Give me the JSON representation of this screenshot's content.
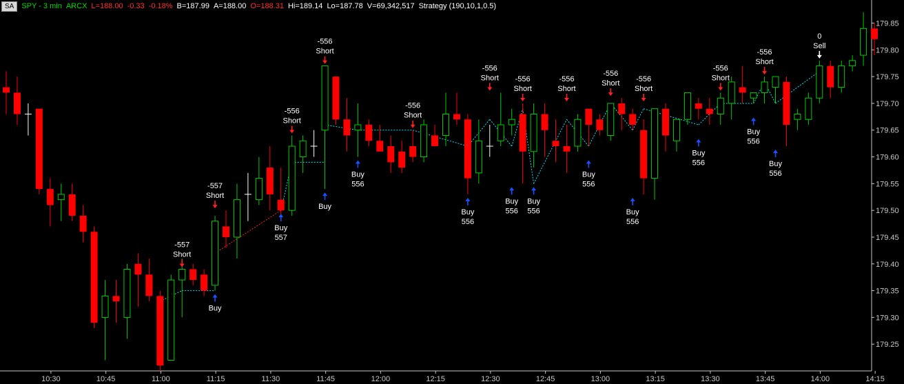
{
  "header": {
    "badge": "SA",
    "symbol": "SPY - 3 min",
    "exchange": "ARCX",
    "last": "L=188.00",
    "change": "-0.33",
    "change_pct": "-0.18%",
    "bid": "B=187.99",
    "ask": "A=188.00",
    "open": "O=188.31",
    "high": "Hi=189.14",
    "low": "Lo=187.78",
    "volume": "V=69,342,517",
    "strategy": "Strategy (190,10,1,0.5)"
  },
  "colors": {
    "background": "#000000",
    "up_candle": "#00cc00",
    "down_candle": "#ff0000",
    "doji": "#ffffff",
    "short_arrow": "#ff2020",
    "buy_arrow": "#1a50ff",
    "sell_arrow": "#ffffff",
    "trade_line_flat": "#00e5ff",
    "trade_line_long": "#ff2020",
    "axis": "#c8c8c8",
    "header_green": "#00d800",
    "header_red": "#ff3030",
    "header_white": "#ffffff"
  },
  "chart_data": {
    "type": "candlestick",
    "interval": "3 min",
    "grid": false,
    "ylim": [
      179.2,
      179.87
    ],
    "y_ticks": [
      "179.85",
      "179.80",
      "179.75",
      "179.70",
      "179.65",
      "179.60",
      "179.55",
      "179.50",
      "179.45",
      "179.40",
      "179.35",
      "179.30",
      "179.25"
    ],
    "x_ticks": [
      {
        "label": "10:30",
        "bar": 2
      },
      {
        "label": "10:45",
        "bar": 7
      },
      {
        "label": "11:00",
        "bar": 12
      },
      {
        "label": "11:15",
        "bar": 17
      },
      {
        "label": "11:30",
        "bar": 22
      },
      {
        "label": "11:45",
        "bar": 27
      },
      {
        "label": "12:00",
        "bar": 32
      },
      {
        "label": "12:15",
        "bar": 37
      },
      {
        "label": "12:30",
        "bar": 42
      },
      {
        "label": "12:45",
        "bar": 47
      },
      {
        "label": "13:00",
        "bar": 52
      },
      {
        "label": "13:15",
        "bar": 57
      },
      {
        "label": "13:30",
        "bar": 62
      },
      {
        "label": "13:45",
        "bar": 67
      },
      {
        "label": "14:00",
        "bar": 72
      },
      {
        "label": "14:15",
        "bar": 77
      }
    ],
    "candles": [
      {
        "o": 179.73,
        "h": 179.76,
        "l": 179.68,
        "c": 179.72
      },
      {
        "o": 179.72,
        "h": 179.75,
        "l": 179.66,
        "c": 179.68
      },
      {
        "o": 179.68,
        "h": 179.7,
        "l": 179.64,
        "c": 179.68
      },
      {
        "o": 179.69,
        "h": 179.69,
        "l": 179.53,
        "c": 179.54
      },
      {
        "o": 179.54,
        "h": 179.56,
        "l": 179.47,
        "c": 179.51
      },
      {
        "o": 179.52,
        "h": 179.55,
        "l": 179.48,
        "c": 179.53
      },
      {
        "o": 179.53,
        "h": 179.55,
        "l": 179.48,
        "c": 179.49
      },
      {
        "o": 179.49,
        "h": 179.51,
        "l": 179.44,
        "c": 179.46
      },
      {
        "o": 179.46,
        "h": 179.47,
        "l": 179.28,
        "c": 179.29
      },
      {
        "o": 179.3,
        "h": 179.37,
        "l": 179.22,
        "c": 179.34
      },
      {
        "o": 179.34,
        "h": 179.37,
        "l": 179.29,
        "c": 179.33
      },
      {
        "o": 179.3,
        "h": 179.4,
        "l": 179.26,
        "c": 179.39
      },
      {
        "o": 179.4,
        "h": 179.42,
        "l": 179.32,
        "c": 179.38
      },
      {
        "o": 179.38,
        "h": 179.41,
        "l": 179.33,
        "c": 179.34
      },
      {
        "o": 179.34,
        "h": 179.35,
        "l": 179.2,
        "c": 179.21
      },
      {
        "o": 179.22,
        "h": 179.38,
        "l": 179.22,
        "c": 179.37
      },
      {
        "o": 179.37,
        "h": 179.41,
        "l": 179.3,
        "c": 179.39
      },
      {
        "o": 179.39,
        "h": 179.4,
        "l": 179.36,
        "c": 179.37
      },
      {
        "o": 179.38,
        "h": 179.39,
        "l": 179.34,
        "c": 179.35
      },
      {
        "o": 179.36,
        "h": 179.49,
        "l": 179.35,
        "c": 179.48
      },
      {
        "o": 179.47,
        "h": 179.5,
        "l": 179.43,
        "c": 179.45
      },
      {
        "o": 179.45,
        "h": 179.55,
        "l": 179.41,
        "c": 179.52
      },
      {
        "o": 179.53,
        "h": 179.57,
        "l": 179.48,
        "c": 179.53
      },
      {
        "o": 179.52,
        "h": 179.6,
        "l": 179.51,
        "c": 179.56
      },
      {
        "o": 179.58,
        "h": 179.62,
        "l": 179.5,
        "c": 179.53
      },
      {
        "o": 179.52,
        "h": 179.58,
        "l": 179.49,
        "c": 179.5
      },
      {
        "o": 179.5,
        "h": 179.64,
        "l": 179.49,
        "c": 179.62
      },
      {
        "o": 179.6,
        "h": 179.64,
        "l": 179.57,
        "c": 179.63
      },
      {
        "o": 179.62,
        "h": 179.65,
        "l": 179.6,
        "c": 179.62
      },
      {
        "o": 179.65,
        "h": 179.77,
        "l": 179.54,
        "c": 179.77
      },
      {
        "o": 179.75,
        "h": 179.75,
        "l": 179.66,
        "c": 179.67
      },
      {
        "o": 179.67,
        "h": 179.71,
        "l": 179.61,
        "c": 179.64
      },
      {
        "o": 179.65,
        "h": 179.7,
        "l": 179.6,
        "c": 179.66
      },
      {
        "o": 179.66,
        "h": 179.67,
        "l": 179.62,
        "c": 179.63
      },
      {
        "o": 179.63,
        "h": 179.66,
        "l": 179.61,
        "c": 179.61
      },
      {
        "o": 179.62,
        "h": 179.64,
        "l": 179.57,
        "c": 179.59
      },
      {
        "o": 179.61,
        "h": 179.63,
        "l": 179.57,
        "c": 179.58
      },
      {
        "o": 179.62,
        "h": 179.65,
        "l": 179.59,
        "c": 179.6
      },
      {
        "o": 179.6,
        "h": 179.67,
        "l": 179.59,
        "c": 179.66
      },
      {
        "o": 179.64,
        "h": 179.66,
        "l": 179.62,
        "c": 179.62
      },
      {
        "o": 179.64,
        "h": 179.72,
        "l": 179.62,
        "c": 179.68
      },
      {
        "o": 179.68,
        "h": 179.72,
        "l": 179.66,
        "c": 179.67
      },
      {
        "o": 179.67,
        "h": 179.68,
        "l": 179.53,
        "c": 179.56
      },
      {
        "o": 179.57,
        "h": 179.67,
        "l": 179.55,
        "c": 179.63
      },
      {
        "o": 179.62,
        "h": 179.66,
        "l": 179.6,
        "c": 179.62
      },
      {
        "o": 179.63,
        "h": 179.72,
        "l": 179.62,
        "c": 179.66
      },
      {
        "o": 179.66,
        "h": 179.69,
        "l": 179.64,
        "c": 179.67
      },
      {
        "o": 179.68,
        "h": 179.7,
        "l": 179.55,
        "c": 179.61
      },
      {
        "o": 179.61,
        "h": 179.7,
        "l": 179.58,
        "c": 179.68
      },
      {
        "o": 179.68,
        "h": 179.7,
        "l": 179.6,
        "c": 179.65
      },
      {
        "o": 179.63,
        "h": 179.67,
        "l": 179.59,
        "c": 179.62
      },
      {
        "o": 179.62,
        "h": 179.66,
        "l": 179.57,
        "c": 179.61
      },
      {
        "o": 179.62,
        "h": 179.68,
        "l": 179.61,
        "c": 179.67
      },
      {
        "o": 179.69,
        "h": 179.69,
        "l": 179.62,
        "c": 179.66
      },
      {
        "o": 179.67,
        "h": 179.68,
        "l": 179.64,
        "c": 179.65
      },
      {
        "o": 179.64,
        "h": 179.69,
        "l": 179.63,
        "c": 179.7
      },
      {
        "o": 179.7,
        "h": 179.71,
        "l": 179.65,
        "c": 179.68
      },
      {
        "o": 179.68,
        "h": 179.69,
        "l": 179.65,
        "c": 179.66
      },
      {
        "o": 179.65,
        "h": 179.67,
        "l": 179.53,
        "c": 179.56
      },
      {
        "o": 179.56,
        "h": 179.69,
        "l": 179.52,
        "c": 179.69
      },
      {
        "o": 179.69,
        "h": 179.7,
        "l": 179.61,
        "c": 179.64
      },
      {
        "o": 179.63,
        "h": 179.67,
        "l": 179.61,
        "c": 179.67
      },
      {
        "o": 179.67,
        "h": 179.72,
        "l": 179.66,
        "c": 179.72
      },
      {
        "o": 179.7,
        "h": 179.71,
        "l": 179.67,
        "c": 179.69
      },
      {
        "o": 179.69,
        "h": 179.71,
        "l": 179.66,
        "c": 179.68
      },
      {
        "o": 179.68,
        "h": 179.72,
        "l": 179.66,
        "c": 179.71
      },
      {
        "o": 179.7,
        "h": 179.75,
        "l": 179.67,
        "c": 179.74
      },
      {
        "o": 179.73,
        "h": 179.77,
        "l": 179.7,
        "c": 179.72
      },
      {
        "o": 179.71,
        "h": 179.72,
        "l": 179.7,
        "c": 179.72
      },
      {
        "o": 179.72,
        "h": 179.75,
        "l": 179.7,
        "c": 179.74
      },
      {
        "o": 179.73,
        "h": 179.75,
        "l": 179.7,
        "c": 179.75
      },
      {
        "o": 179.74,
        "h": 179.75,
        "l": 179.62,
        "c": 179.66
      },
      {
        "o": 179.67,
        "h": 179.69,
        "l": 179.65,
        "c": 179.68
      },
      {
        "o": 179.67,
        "h": 179.72,
        "l": 179.66,
        "c": 179.71
      },
      {
        "o": 179.71,
        "h": 179.78,
        "l": 179.7,
        "c": 179.77
      },
      {
        "o": 179.77,
        "h": 179.78,
        "l": 179.71,
        "c": 179.73
      },
      {
        "o": 179.73,
        "h": 179.78,
        "l": 179.72,
        "c": 179.77
      },
      {
        "o": 179.77,
        "h": 179.79,
        "l": 179.76,
        "c": 179.78
      },
      {
        "o": 179.79,
        "h": 179.87,
        "l": 179.77,
        "c": 179.84
      },
      {
        "o": 179.84,
        "h": 179.85,
        "l": 179.79,
        "c": 179.82
      }
    ],
    "signals": [
      {
        "bar": 16,
        "type": "short",
        "qty": "-557",
        "label": "Short",
        "price": 179.39
      },
      {
        "bar": 19,
        "type": "buy",
        "qty": "",
        "label": "Buy",
        "price": 179.35
      },
      {
        "bar": 19,
        "type": "short",
        "qty": "-557",
        "label": "Short",
        "price": 179.5
      },
      {
        "bar": 25,
        "type": "buy",
        "qty": "557",
        "label": "Buy",
        "price": 179.5
      },
      {
        "bar": 26,
        "type": "short",
        "qty": "-556",
        "label": "Short",
        "price": 179.64
      },
      {
        "bar": 29,
        "type": "short",
        "qty": "-556",
        "label": "Short",
        "price": 179.77
      },
      {
        "bar": 29,
        "type": "buy",
        "qty": "",
        "label": "Buy",
        "price": 179.54
      },
      {
        "bar": 32,
        "type": "buy",
        "qty": "556",
        "label": "Buy",
        "price": 179.6
      },
      {
        "bar": 37,
        "type": "short",
        "qty": "-556",
        "label": "Short",
        "price": 179.65
      },
      {
        "bar": 42,
        "type": "buy",
        "qty": "556",
        "label": "Buy",
        "price": 179.53
      },
      {
        "bar": 44,
        "type": "short",
        "qty": "-556",
        "label": "Short",
        "price": 179.72
      },
      {
        "bar": 46,
        "type": "buy",
        "qty": "556",
        "label": "Buy",
        "price": 179.55
      },
      {
        "bar": 47,
        "type": "short",
        "qty": "-556",
        "label": "Short",
        "price": 179.7
      },
      {
        "bar": 48,
        "type": "buy",
        "qty": "556",
        "label": "Buy",
        "price": 179.55
      },
      {
        "bar": 51,
        "type": "short",
        "qty": "-556",
        "label": "Short",
        "price": 179.7
      },
      {
        "bar": 53,
        "type": "buy",
        "qty": "556",
        "label": "Buy",
        "price": 179.6
      },
      {
        "bar": 55,
        "type": "short",
        "qty": "-556",
        "label": "Short",
        "price": 179.71
      },
      {
        "bar": 57,
        "type": "buy",
        "qty": "556",
        "label": "Buy",
        "price": 179.53
      },
      {
        "bar": 58,
        "type": "short",
        "qty": "-556",
        "label": "Short",
        "price": 179.7
      },
      {
        "bar": 63,
        "type": "buy",
        "qty": "556",
        "label": "Buy",
        "price": 179.64
      },
      {
        "bar": 65,
        "type": "short",
        "qty": "-556",
        "label": "Short",
        "price": 179.72
      },
      {
        "bar": 68,
        "type": "buy",
        "qty": "556",
        "label": "Buy",
        "price": 179.68
      },
      {
        "bar": 69,
        "type": "short",
        "qty": "-556",
        "label": "Short",
        "price": 179.75
      },
      {
        "bar": 70,
        "type": "buy",
        "qty": "556",
        "label": "Buy",
        "price": 179.62
      },
      {
        "bar": 74,
        "type": "sell",
        "qty": "0",
        "label": "Sell",
        "price": 179.78
      }
    ],
    "trade_path": [
      {
        "bar": 14,
        "price": 179.33,
        "style": "flat"
      },
      {
        "bar": 16,
        "price": 179.35,
        "style": "flat"
      },
      {
        "bar": 19,
        "price": 179.35,
        "style": "long"
      },
      {
        "bar": 19,
        "price": 179.42,
        "style": "long"
      },
      {
        "bar": 25,
        "price": 179.5,
        "style": "flat"
      },
      {
        "bar": 26,
        "price": 179.59,
        "style": "flat"
      },
      {
        "bar": 29,
        "price": 179.59,
        "style": "flat"
      },
      {
        "bar": 29,
        "price": 179.66,
        "style": "flat"
      },
      {
        "bar": 32,
        "price": 179.65,
        "style": "flat"
      },
      {
        "bar": 37,
        "price": 179.65,
        "style": "flat"
      },
      {
        "bar": 42,
        "price": 179.62,
        "style": "flat"
      },
      {
        "bar": 44,
        "price": 179.67,
        "style": "flat"
      },
      {
        "bar": 46,
        "price": 179.62,
        "style": "flat"
      },
      {
        "bar": 47,
        "price": 179.69,
        "style": "flat"
      },
      {
        "bar": 48,
        "price": 179.55,
        "style": "flat"
      },
      {
        "bar": 51,
        "price": 179.67,
        "style": "flat"
      },
      {
        "bar": 53,
        "price": 179.62,
        "style": "flat"
      },
      {
        "bar": 55,
        "price": 179.7,
        "style": "flat"
      },
      {
        "bar": 57,
        "price": 179.65,
        "style": "flat"
      },
      {
        "bar": 58,
        "price": 179.69,
        "style": "flat"
      },
      {
        "bar": 63,
        "price": 179.66,
        "style": "flat"
      },
      {
        "bar": 65,
        "price": 179.7,
        "style": "flat"
      },
      {
        "bar": 68,
        "price": 179.7,
        "style": "flat"
      },
      {
        "bar": 69,
        "price": 179.74,
        "style": "flat"
      },
      {
        "bar": 70,
        "price": 179.7,
        "style": "flat"
      },
      {
        "bar": 74,
        "price": 179.76,
        "style": "flat"
      }
    ]
  }
}
